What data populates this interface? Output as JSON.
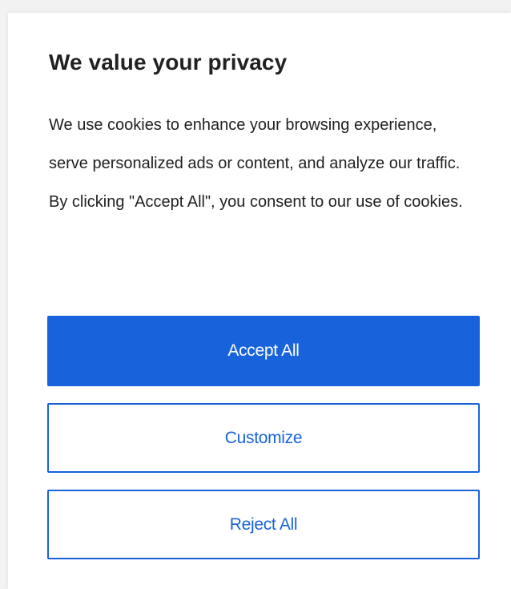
{
  "banner": {
    "title": "We value your privacy",
    "description": "We use cookies to enhance your browsing experience, serve personalized ads or content, and analyze our traffic. By clicking \"Accept All\", you consent to our use of cookies.",
    "buttons": {
      "accept": "Accept All",
      "customize": "Customize",
      "reject": "Reject All"
    }
  },
  "colors": {
    "accent": "#1863dc",
    "text": "#212121",
    "background": "#ffffff"
  }
}
